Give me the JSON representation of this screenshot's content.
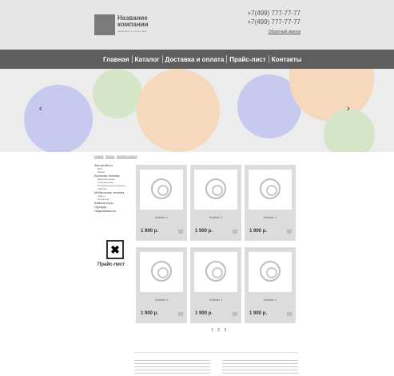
{
  "header": {
    "company_name": "Название компании",
    "company_tagline": "свадебные и путешествия",
    "phones": [
      "+7(499) 777-77-77",
      "+7(499) 777-77-77"
    ],
    "callback": "Обратный звонок",
    "logo_color": "#7a7a7a",
    "background": "#e6e6e6"
  },
  "nav": {
    "background": "#5e5e5e",
    "items": [
      "Главная",
      "Каталог",
      "Доставка и оплата",
      "Прайс-лист",
      "Контакты"
    ]
  },
  "slider": {
    "prev_icon": "chevron-left-icon",
    "next_icon": "chevron-right-icon",
    "prev_glyph": "‹",
    "next_glyph": "›",
    "circle_colors": [
      "#c8c9ef",
      "#d5e5c8",
      "#f6d8bc"
    ]
  },
  "breadcrumb": [
    "Главная",
    "Каталог",
    "Название раздела"
  ],
  "sidebar": {
    "categories": [
      {
        "label": "Автомобили",
        "subs": [
          "ВАЗ",
          "Мазда"
        ]
      },
      {
        "label": "Бытовая техника",
        "subs": [
          "Микроволновки",
          "Холодильники",
          "Посудомоечные машины",
          "Чайники"
        ]
      },
      {
        "label": "Мобильные техника",
        "subs": [
          "Айфон",
          "Телефоны"
        ]
      },
      {
        "label": "Компьютеры",
        "subs": []
      },
      {
        "label": "Одежда",
        "subs": []
      },
      {
        "label": "Недвижимость",
        "subs": []
      }
    ],
    "pricelist_label": "Прайс-лист",
    "pricelist_icon": "excel-icon",
    "pricelist_glyph": "✖"
  },
  "products": [
    {
      "title": "Чайник 1",
      "price": "1 900 р."
    },
    {
      "title": "Чайник 1",
      "price": "1 900 р."
    },
    {
      "title": "Чайник 1",
      "price": "1 900 р."
    },
    {
      "title": "Чайник 1",
      "price": "1 900 р."
    },
    {
      "title": "Чайник 1",
      "price": "1 900 р."
    },
    {
      "title": "Чайник 1",
      "price": "1 900 р."
    }
  ],
  "pagination": [
    "1",
    "2",
    "3"
  ]
}
